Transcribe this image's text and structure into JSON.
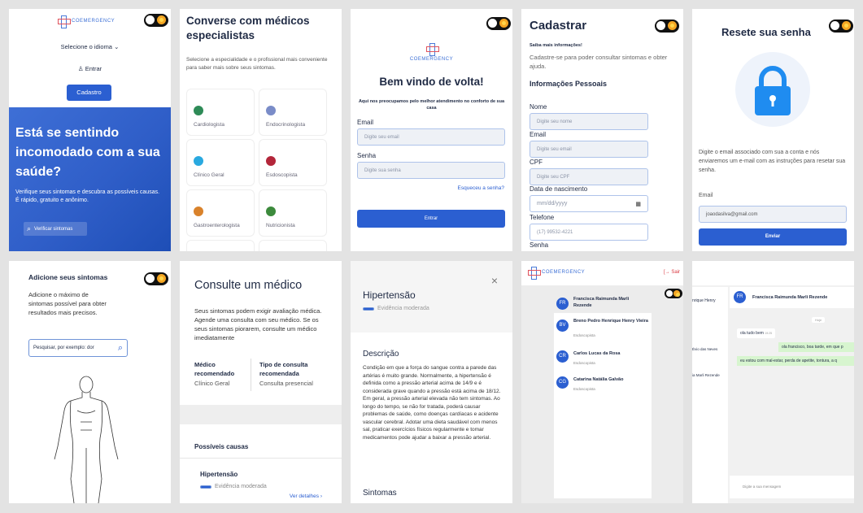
{
  "brand": "COEMERGENCY",
  "home": {
    "language_select": "Selecione o idioma",
    "login": "Entrar",
    "signup": "Cadastro",
    "hero_title": "Está se sentindo incomodado com a sua saúde?",
    "hero_subtitle": "Verifique seus sintomas e descubra as possíveis causas. É rápido, gratuito e anônimo.",
    "check_button": "Verificar sintomas"
  },
  "specialists": {
    "title": "Converse com médicos especialistas",
    "subtitle": "Selecione a especialidade e o profissional mais conveniente para saber mais sobre seus sintomas.",
    "items": [
      {
        "label": "Cardiologista",
        "icon": "heart-icon",
        "color": "#2e8b57"
      },
      {
        "label": "Endocrinologista",
        "icon": "gland-icon",
        "color": "#7a8cc8"
      },
      {
        "label": "Clínico Geral",
        "icon": "stethoscope-icon",
        "color": "#29a9e0"
      },
      {
        "label": "Esdoscopista",
        "icon": "stomach-icon",
        "color": "#b3263a"
      },
      {
        "label": "Gastroenterologista",
        "icon": "intestine-icon",
        "color": "#d9822b"
      },
      {
        "label": "Nutricionista",
        "icon": "carrot-icon",
        "color": "#3c8a3c"
      }
    ]
  },
  "login": {
    "welcome": "Bem vindo de volta!",
    "tagline": "Aqui nos preocupamos pelo melhor atendimento no conforto de sua casa",
    "email_label": "Email",
    "email_placeholder": "Digite seu email",
    "password_label": "Senha",
    "password_placeholder": "Digite sua senha",
    "forgot": "Esqueceu a senha?",
    "submit": "Entrar"
  },
  "register": {
    "title": "Cadastrar",
    "more_info": "Saiba mais informações!",
    "intro": "Cadastre-se para poder consultar sintomas e obter ajuda.",
    "section": "Informações Pessoais",
    "name_label": "Nome",
    "name_placeholder": "Digite seu nome",
    "email_label": "Email",
    "email_placeholder": "Digite seu email",
    "cpf_label": "CPF",
    "cpf_placeholder": "Digite seu CPF",
    "birth_label": "Data de nascimento",
    "birth_placeholder": "mm/dd/yyyy",
    "phone_label": "Telefone",
    "phone_placeholder": "(17) 99532-4221",
    "password_label": "Senha"
  },
  "reset": {
    "title": "Resete sua senha",
    "description": "Digite o email associado com sua a conta e nós enviaremos um e-mail com as instruções para resetar sua senha.",
    "email_label": "Email",
    "email_value": "joaodasilva@gmail.com",
    "submit": "Enviar"
  },
  "symptoms": {
    "title": "Adicione seus sintomas",
    "subtitle": "Adicione o máximo de sintomas possível para obter resultados mais precisos.",
    "search_placeholder": "Pesquisar, por exemplo: dor"
  },
  "consult": {
    "title": "Consulte um médico",
    "text": "Seus sintomas podem exigir avaliação médica. Agende uma consulta com seu médico. Se os seus sintomas piorarem, consulte um médico imediatamente",
    "doctor_label": "Médico recomendado",
    "doctor_value": "Clínico Geral",
    "type_label": "Tipo de consulta recomendada",
    "type_value": "Consulta presencial",
    "causes_title": "Possíveis causas",
    "cause_name": "Hipertensão",
    "cause_evidence": "Evidência moderada",
    "details": "Ver detalhes"
  },
  "condition": {
    "title": "Hipertensão",
    "evidence": "Evidência moderada",
    "desc_title": "Descrição",
    "description": "Condição em que a força do sangue contra a parede das artérias é muito grande. Normalmente, a hipertensão é definida como a pressão arterial acima de 14/9 e é considerada grave quando a pressão está acima de 18/12. Em geral, a pressão arterial elevada não tem sintomas. Ao longo do tempo, se não for tratada, poderá causar problemas de saúde, como doenças cardíacas e acidente vascular cerebral. Adotar uma dieta saudável com menos sal, praticar exercícios físicos regularmente e tomar medicamentos pode ajudar a baixar a pressão arterial.",
    "symptoms_title": "Sintomas"
  },
  "contacts": {
    "logout": "Sair",
    "items": [
      {
        "initials": "FR",
        "name": "Francisca Raimunda Marli Rezende",
        "role": ""
      },
      {
        "initials": "BV",
        "name": "Breno Pedro Henrique Henry Vieira",
        "role": "Esdoscopista"
      },
      {
        "initials": "CR",
        "name": "Carlos Lucas da Rosa",
        "role": "Esdoscopista"
      },
      {
        "initials": "CG",
        "name": "Catarina Natália Galvão",
        "role": "Esdoscopista"
      }
    ]
  },
  "chat": {
    "partial_list": [
      "nrique Henry",
      "Évio das Neves",
      "ia Marli Rezende"
    ],
    "contact_initials": "FR",
    "contact_name": "Francisca Raimunda Marli Rezende",
    "day": "Hoje",
    "messages": [
      {
        "side": "left",
        "text": "ola tudo bem",
        "time": "19:25"
      },
      {
        "side": "right",
        "text": "ola francisco, boa tarde, em que p"
      },
      {
        "side": "right",
        "text": "eu estou com mal-estar, perda de apetite, tontura, a q"
      }
    ],
    "input_placeholder": "Digite a sua mensagem"
  }
}
